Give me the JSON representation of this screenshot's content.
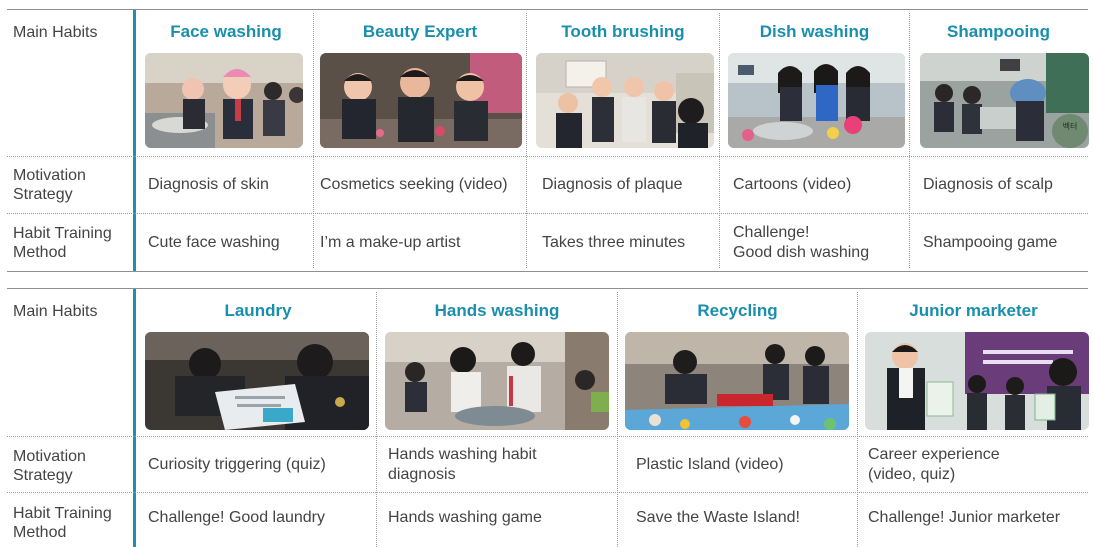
{
  "table1": {
    "row_labels": {
      "main": "Main Habits",
      "motivation": "Motivation Strategy",
      "method": "Habit Training Method"
    },
    "columns": [
      {
        "title": "Face washing",
        "motivation": "Diagnosis of skin",
        "method": "Cute face washing",
        "photo_icon": "face-washing-photo"
      },
      {
        "title": "Beauty Expert",
        "motivation": "Cosmetics seeking (video)",
        "method": "I’m a make-up artist",
        "photo_icon": "beauty-expert-photo"
      },
      {
        "title": "Tooth brushing",
        "motivation": "Diagnosis of plaque",
        "method": "Takes three minutes",
        "photo_icon": "tooth-brushing-photo"
      },
      {
        "title": "Dish washing",
        "motivation": "Cartoons (video)",
        "method": "Challenge!\nGood dish washing",
        "photo_icon": "dish-washing-photo"
      },
      {
        "title": "Shampooing",
        "motivation": "Diagnosis of scalp",
        "method": "Shampooing game",
        "photo_icon": "shampooing-photo"
      }
    ]
  },
  "table2": {
    "row_labels": {
      "main": "Main Habits",
      "motivation": "Motivation Strategy",
      "method": "Habit Training Method"
    },
    "columns": [
      {
        "title": "Laundry",
        "motivation": "Curiosity triggering (quiz)",
        "method": "Challenge! Good laundry",
        "photo_icon": "laundry-photo"
      },
      {
        "title": "Hands washing",
        "motivation": "Hands washing habit diagnosis",
        "method": "Hands washing game",
        "photo_icon": "hands-washing-photo"
      },
      {
        "title": "Recycling",
        "motivation": "Plastic Island (video)",
        "method": "Save the Waste Island!",
        "photo_icon": "recycling-photo"
      },
      {
        "title": "Junior marketer",
        "motivation": "Career experience (video, quiz)",
        "method": "Challenge! Junior marketer",
        "photo_icon": "junior-marketer-photo"
      }
    ]
  },
  "colors": {
    "accent": "#1d8fb0",
    "heading": "#1a8fad",
    "text": "#444444",
    "rule": "#8f8f8f"
  }
}
